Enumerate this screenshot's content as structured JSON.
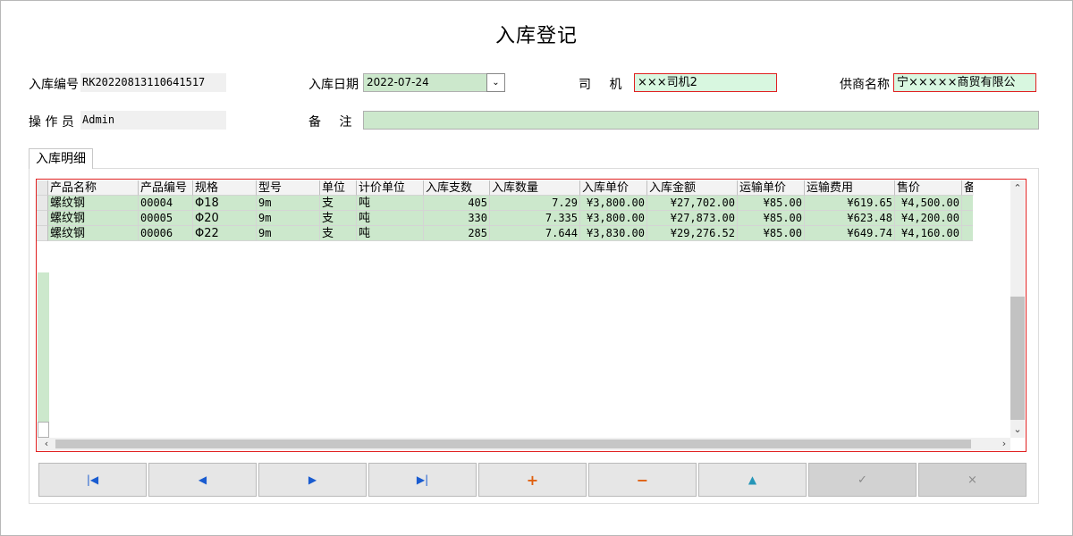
{
  "title": "入库登记",
  "form": {
    "order_no_label": "入库编号",
    "order_no": "RK20220813110641517",
    "date_label": "入库日期",
    "date": "2022-07-24",
    "driver_label": "司  机",
    "driver": "×××司机2",
    "supplier_label": "供商名称",
    "supplier": "宁×××××商贸有限公",
    "operator_label": "操 作 员",
    "operator": "Admin",
    "remark_label": "备  注",
    "remark": ""
  },
  "tab": {
    "label": "入库明细"
  },
  "grid": {
    "columns": [
      "产品名称",
      "产品编号",
      "规格",
      "型号",
      "单位",
      "计价单位",
      "入库支数",
      "入库数量",
      "入库单价",
      "入库金额",
      "运输单价",
      "运输费用",
      "售价",
      "备"
    ],
    "rows": [
      [
        "螺纹钢",
        "00004",
        "Φ18",
        "9m",
        "支",
        "吨",
        "405",
        "7.29",
        "¥3,800.00",
        "¥27,702.00",
        "¥85.00",
        "¥619.65",
        "¥4,500.00",
        ""
      ],
      [
        "螺纹钢",
        "00005",
        "Φ20",
        "9m",
        "支",
        "吨",
        "330",
        "7.335",
        "¥3,800.00",
        "¥27,873.00",
        "¥85.00",
        "¥623.48",
        "¥4,200.00",
        ""
      ],
      [
        "螺纹钢",
        "00006",
        "Φ22",
        "9m",
        "支",
        "吨",
        "285",
        "7.644",
        "¥3,830.00",
        "¥29,276.52",
        "¥85.00",
        "¥649.74",
        "¥4,160.00",
        ""
      ]
    ]
  },
  "nav": {
    "first": "|◀",
    "prev": "◀",
    "next": "▶",
    "last": "▶|",
    "add": "+",
    "delete": "−",
    "edit": "▲",
    "post": "✓",
    "cancel": "×"
  },
  "icons": {
    "date_dropdown": "chevron-down-icon",
    "scroll_up": "chevron-up-icon",
    "scroll_down": "chevron-down-icon",
    "scroll_left": "chevron-left-icon",
    "scroll_right": "chevron-right-icon"
  },
  "colors": {
    "field_bg": "#cce8cc",
    "required_border": "#e02020",
    "grid_border": "#e02020"
  }
}
